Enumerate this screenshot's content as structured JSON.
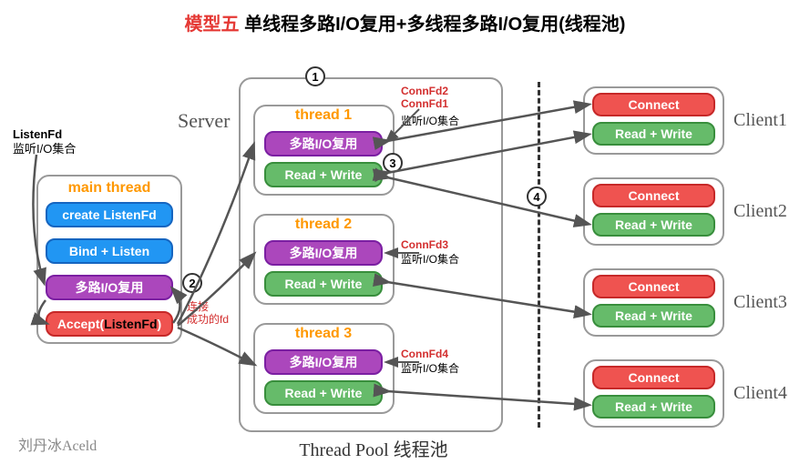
{
  "title": {
    "red": "模型五",
    "black": " 单线程多路I/O复用+多线程多路I/O复用(线程池)"
  },
  "server_label": "Server",
  "main_thread": {
    "title": "main thread",
    "rows": [
      {
        "type": "blue",
        "text": "create ListenFd"
      },
      {
        "type": "blue",
        "text": "Bind + Listen"
      },
      {
        "type": "purple",
        "text": "多路I/O复用"
      },
      {
        "type": "red",
        "html": "Accept(<span style='color:#000'>ListenFd</span>)"
      }
    ]
  },
  "listen_note": {
    "l1": "ListenFd",
    "l2": "监听I/O集合"
  },
  "conn_note_red": "连接\n成功的fd",
  "threads": [
    {
      "title": "thread 1",
      "io": "多路I/O复用",
      "rw": "Read + Write",
      "conn": "ConnFd2\nConnFd1",
      "listen": "监听I/O集合"
    },
    {
      "title": "thread 2",
      "io": "多路I/O复用",
      "rw": "Read + Write",
      "conn": "ConnFd3",
      "listen": "监听I/O集合"
    },
    {
      "title": "thread 3",
      "io": "多路I/O复用",
      "rw": "Read + Write",
      "conn": "ConnFd4",
      "listen": "监听I/O集合"
    }
  ],
  "threadpool_label": "Thread Pool 线程池",
  "clients": [
    {
      "connect": "Connect",
      "rw": "Read + Write",
      "name": "Client1"
    },
    {
      "connect": "Connect",
      "rw": "Read + Write",
      "name": "Client2"
    },
    {
      "connect": "Connect",
      "rw": "Read + Write",
      "name": "Client3"
    },
    {
      "connect": "Connect",
      "rw": "Read + Write",
      "name": "Client4"
    }
  ],
  "steps": {
    "s1": "1",
    "s2": "2",
    "s3": "3",
    "s4": "4"
  },
  "signature": "刘丹冰Aceld"
}
